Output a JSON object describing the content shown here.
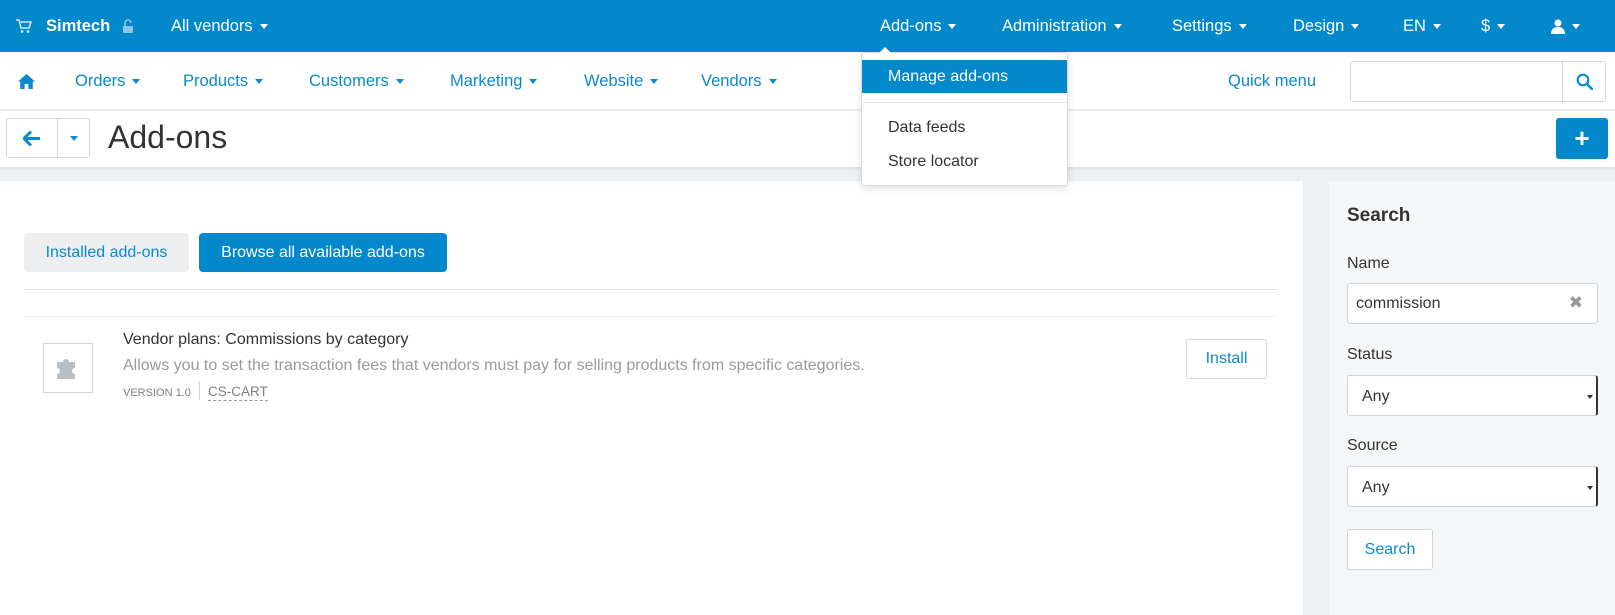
{
  "topbar": {
    "store_name": "Simtech",
    "vendors": "All vendors",
    "addons": "Add-ons",
    "administration": "Administration",
    "settings": "Settings",
    "design": "Design",
    "language": "EN",
    "currency": "$",
    "colors": {
      "background": "#0388cc"
    }
  },
  "nav": {
    "orders": "Orders",
    "products": "Products",
    "customers": "Customers",
    "marketing": "Marketing",
    "website": "Website",
    "vendors": "Vendors",
    "quick_menu": "Quick menu",
    "search_value": ""
  },
  "page": {
    "title": "Add-ons",
    "add_button": "+"
  },
  "tabs": {
    "installed": "Installed add-ons",
    "browse": "Browse all available add-ons"
  },
  "addon": {
    "name": "Vendor plans: Commissions by category",
    "description": "Allows you to set the transaction fees that vendors must pay for selling products from specific categories.",
    "version": "VERSION 1.0",
    "source": "CS-CART",
    "install_label": "Install"
  },
  "sidebar": {
    "title": "Search",
    "name_label": "Name",
    "name_value": "commission",
    "status_label": "Status",
    "status_value": "Any",
    "source_label": "Source",
    "source_value": "Any",
    "search_button": "Search"
  },
  "dropdown": {
    "items": [
      "Manage add-ons",
      "Data feeds",
      "Store locator"
    ],
    "selected": "Manage add-ons"
  },
  "icons": [
    "cart-icon",
    "lock-icon",
    "user-icon",
    "home-icon",
    "search-icon",
    "back-arrow-icon",
    "puzzle-icon",
    "clear-icon"
  ]
}
